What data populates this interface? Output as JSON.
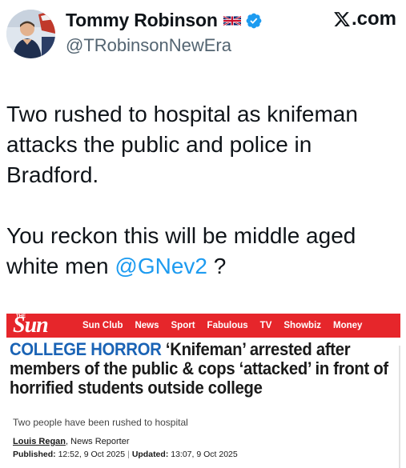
{
  "user": {
    "display_name": "Tommy Robinson",
    "handle": "@TRobinsonNewEra",
    "flag_icon": "uk-flag-icon",
    "verified_icon": "verified-badge-icon",
    "verified_color": "#1d9bf0"
  },
  "brand": {
    "label": ".com",
    "icon": "x-logo-icon"
  },
  "tweet": {
    "line1": "Two rushed to hospital as knifeman attacks the public and police in Bradford.",
    "line2_before": "You reckon this will be middle aged white men ",
    "mention": "@GNev2",
    "line2_after": " ?"
  },
  "article": {
    "masthead_small": "THE",
    "masthead": "Sun",
    "nav": [
      "Sun Club",
      "News",
      "Sport",
      "Fabulous",
      "TV",
      "Showbiz",
      "Money"
    ],
    "kicker": "COLLEGE HORROR",
    "headline": " ‘Knifeman’ arrested after members of the public & cops ‘attacked’ in front of horrified students outside college",
    "subhead": "Two people have been rushed to hospital",
    "author_name": "Louis Regan",
    "author_role": ", News Reporter",
    "published_label": "Published:",
    "published_value": " 12:52, 9 Oct 2025",
    "separator": "|",
    "updated_label": "Updated:",
    "updated_value": " 13:07, 9 Oct 2025",
    "nav_color": "#e6262b",
    "kicker_color": "#1a63b5"
  }
}
